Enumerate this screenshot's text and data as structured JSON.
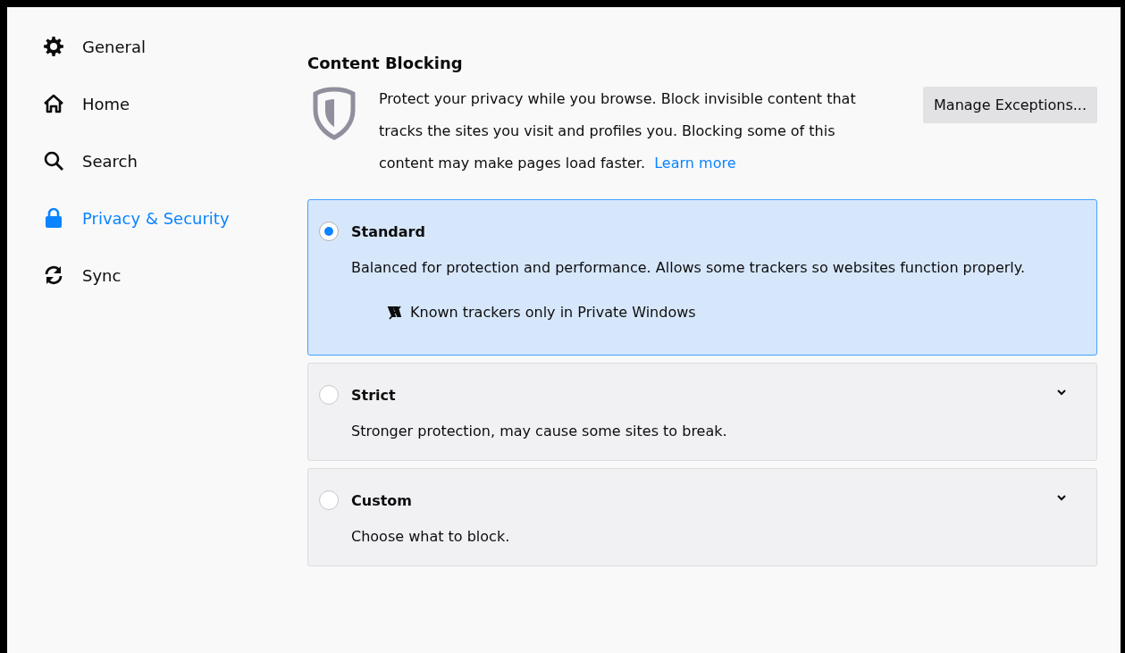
{
  "sidebar": {
    "items": [
      {
        "label": "General",
        "kind": "gear",
        "selected": false
      },
      {
        "label": "Home",
        "kind": "home",
        "selected": false
      },
      {
        "label": "Search",
        "kind": "search",
        "selected": false
      },
      {
        "label": "Privacy & Security",
        "kind": "lock",
        "selected": true
      },
      {
        "label": "Sync",
        "kind": "sync",
        "selected": false
      }
    ]
  },
  "content_blocking": {
    "title": "Content Blocking",
    "description": "Protect your privacy while you browse. Block invisible content that tracks the sites you visit and profiles you. Blocking some of this content may make pages load faster.",
    "learn_more": "Learn more",
    "manage_button": "Manage Exceptions...",
    "options": [
      {
        "label": "Standard",
        "description": "Balanced for protection and performance. Allows some trackers so websites function properly.",
        "selected": true,
        "expanded": true,
        "details": [
          "Known trackers only in Private Windows"
        ]
      },
      {
        "label": "Strict",
        "description": "Stronger protection, may cause some sites to break.",
        "selected": false,
        "expanded": false
      },
      {
        "label": "Custom",
        "description": "Choose what to block.",
        "selected": false,
        "expanded": false
      }
    ]
  }
}
